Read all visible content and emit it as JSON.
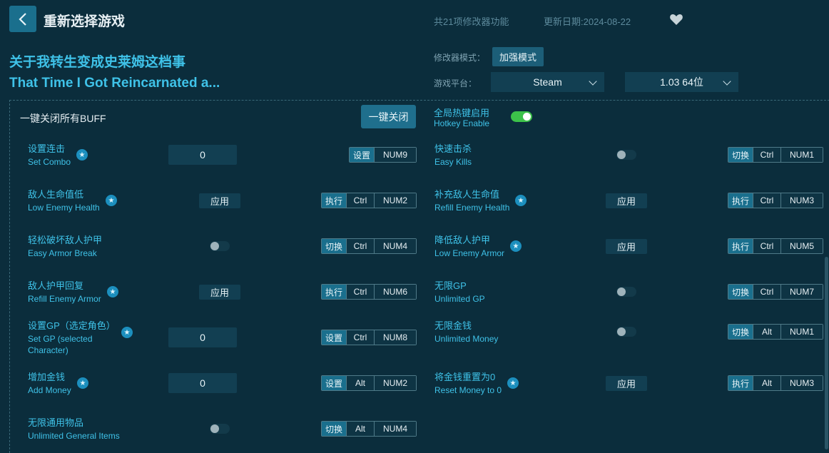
{
  "header": {
    "title": "重新选择游戏",
    "feature_count": "共21项修改器功能",
    "update_date": "更新日期:2024-08-22"
  },
  "game": {
    "name_cn": "关于我转生变成史莱姆这档事",
    "name_en": "That Time I Got Reincarnated a..."
  },
  "settings": {
    "mode_label": "修改器模式：",
    "mode_value": "加强模式",
    "platform_label": "游戏平台：",
    "platform_value": "Steam",
    "version_value": "1.03 64位"
  },
  "global": {
    "disable_all_label": "一键关闭所有BUFF",
    "disable_all_button": "一键关闭",
    "hotkey_label_cn": "全局热键启用",
    "hotkey_label_en": "Hotkey Enable",
    "hotkey_enabled": true
  },
  "cheats_left": [
    {
      "cn": "设置连击",
      "en": "Set Combo",
      "control": "input",
      "value": "0",
      "action": "设置",
      "keys": [
        "NUM9"
      ],
      "star": true
    },
    {
      "cn": "敌人生命值低",
      "en": "Low Enemy Health",
      "control": "apply",
      "value": "应用",
      "action": "执行",
      "keys": [
        "Ctrl",
        "NUM2"
      ],
      "star": true
    },
    {
      "cn": "轻松破坏敌人护甲",
      "en": "Easy Armor Break",
      "control": "toggle",
      "action": "切换",
      "keys": [
        "Ctrl",
        "NUM4"
      ],
      "star": false
    },
    {
      "cn": "敌人护甲回复",
      "en": "Refill Enemy Armor",
      "control": "apply",
      "value": "应用",
      "action": "执行",
      "keys": [
        "Ctrl",
        "NUM6"
      ],
      "star": true
    },
    {
      "cn": "设置GP（选定角色）",
      "en": "Set GP (selected",
      "en2": "Character)",
      "control": "input",
      "value": "0",
      "action": "设置",
      "keys": [
        "Ctrl",
        "NUM8"
      ],
      "star": true
    },
    {
      "cn": "增加金钱",
      "en": "Add Money",
      "control": "input",
      "value": "0",
      "action": "设置",
      "keys": [
        "Alt",
        "NUM2"
      ],
      "star": true
    },
    {
      "cn": "无限通用物品",
      "en": "Unlimited General Items",
      "control": "toggle",
      "action": "切换",
      "keys": [
        "Alt",
        "NUM4"
      ],
      "star": false
    }
  ],
  "cheats_right": [
    {
      "cn": "快速击杀",
      "en": "Easy Kills",
      "control": "toggle",
      "action": "切换",
      "keys": [
        "Ctrl",
        "NUM1"
      ],
      "star": false
    },
    {
      "cn": "补充敌人生命值",
      "en": "Refill Enemy Health",
      "control": "apply",
      "value": "应用",
      "action": "执行",
      "keys": [
        "Ctrl",
        "NUM3"
      ],
      "star": true
    },
    {
      "cn": "降低敌人护甲",
      "en": "Low Enemy Armor",
      "control": "apply",
      "value": "应用",
      "action": "执行",
      "keys": [
        "Ctrl",
        "NUM5"
      ],
      "star": true
    },
    {
      "cn": "无限GP",
      "en": "Unlimited GP",
      "control": "toggle",
      "action": "切换",
      "keys": [
        "Ctrl",
        "NUM7"
      ],
      "star": false
    },
    {
      "cn": "无限金钱",
      "en": "Unlimited Money",
      "control": "toggle",
      "action": "切换",
      "keys": [
        "Alt",
        "NUM1"
      ],
      "star": false
    },
    {
      "cn": "将金钱重置为0",
      "en": "Reset Money to 0",
      "control": "apply",
      "value": "应用",
      "action": "执行",
      "keys": [
        "Alt",
        "NUM3"
      ],
      "star": true
    }
  ],
  "colors": {
    "background": "#0b2d3c",
    "accent": "#3fc2e8",
    "button": "#1a6f8d",
    "toggle_on": "#3cc24a"
  }
}
